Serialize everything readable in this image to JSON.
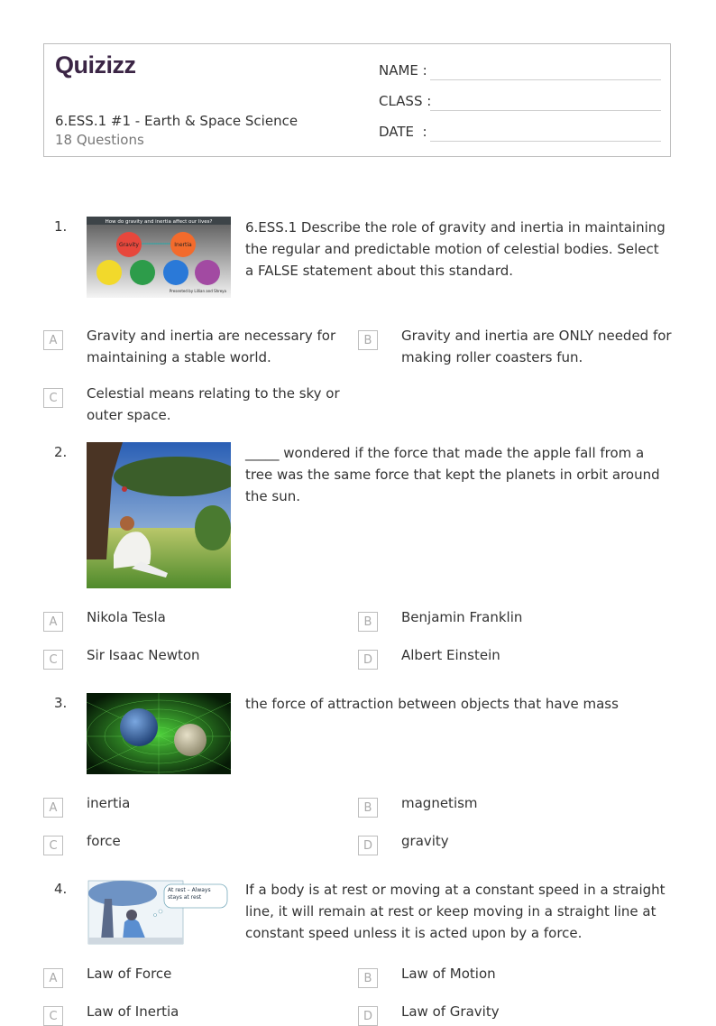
{
  "header": {
    "logo": "QUIZIZZ",
    "title": "6.ESS.1 #1 - Earth & Space Science",
    "question_count": "18 Questions",
    "fields": [
      {
        "label": "NAME :"
      },
      {
        "label": "CLASS :"
      },
      {
        "label": "DATE  :"
      }
    ]
  },
  "questions": [
    {
      "number": "1.",
      "image": "gravity-inertia-diagram",
      "image_caption": "How do gravity and inertia affect our lives?",
      "image_labels": [
        "Gravity",
        "Inertia",
        "Presented by Lillian and Shreya"
      ],
      "text": "6.ESS.1 Describe the role of gravity and inertia in maintaining the regular and predictable motion of celestial bodies. Select a FALSE statement about this standard.",
      "options": [
        {
          "letter": "A",
          "text": "Gravity and inertia are necessary for maintaining a stable world."
        },
        {
          "letter": "B",
          "text": "Gravity and inertia are ONLY needed for making roller coasters fun."
        },
        {
          "letter": "C",
          "text": "Celestial means relating to the sky or outer space."
        }
      ]
    },
    {
      "number": "2.",
      "image": "newton-apple-tree-painting",
      "text": "_____ wondered if the force that made the apple fall from a tree was the same force that kept the planets in orbit around the sun.",
      "options": [
        {
          "letter": "A",
          "text": "Nikola Tesla"
        },
        {
          "letter": "B",
          "text": "Benjamin Franklin"
        },
        {
          "letter": "C",
          "text": "Sir Isaac Newton"
        },
        {
          "letter": "D",
          "text": "Albert Einstein"
        }
      ]
    },
    {
      "number": "3.",
      "image": "earth-moon-spacetime-grid",
      "text": "the force of attraction between objects that have mass",
      "options": [
        {
          "letter": "A",
          "text": "inertia"
        },
        {
          "letter": "B",
          "text": "magnetism"
        },
        {
          "letter": "C",
          "text": "force"
        },
        {
          "letter": "D",
          "text": "gravity"
        }
      ]
    },
    {
      "number": "4.",
      "image": "newton-at-rest-cartoon",
      "image_bubble": "At rest – Always stays at rest",
      "text": "If a body is at rest or moving at a constant speed in a straight line, it will remain at rest or keep moving in a straight line at constant speed unless it is acted upon by a force.",
      "options": [
        {
          "letter": "A",
          "text": "Law of Force"
        },
        {
          "letter": "B",
          "text": "Law of Motion"
        },
        {
          "letter": "C",
          "text": "Law of Inertia"
        },
        {
          "letter": "D",
          "text": "Law of Gravity"
        }
      ]
    }
  ]
}
